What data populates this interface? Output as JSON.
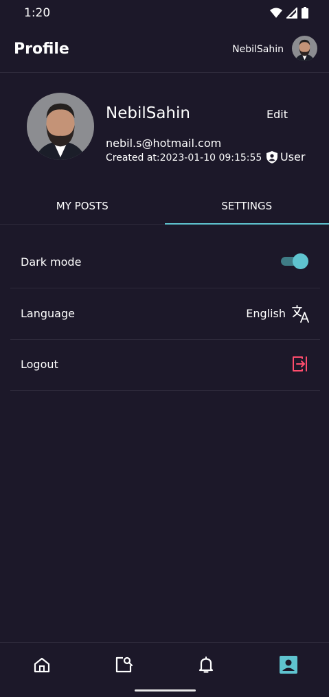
{
  "status": {
    "time": "1:20"
  },
  "app_bar": {
    "title": "Profile",
    "username": "NebilSahin"
  },
  "profile": {
    "name": "NebilSahin",
    "edit_label": "Edit",
    "email": "nebil.s@hotmail.com",
    "created": "Created at:2023-01-10 09:15:55",
    "role": "User"
  },
  "tabs": [
    {
      "label": "MY POSTS",
      "active": false
    },
    {
      "label": "SETTINGS",
      "active": true
    }
  ],
  "settings": {
    "dark_mode": {
      "label": "Dark mode",
      "enabled": true
    },
    "language": {
      "label": "Language",
      "value": "English",
      "icon": "translate-icon"
    },
    "logout": {
      "label": "Logout",
      "icon": "logout-icon"
    }
  },
  "bottom_nav": [
    {
      "icon": "home-icon",
      "active": false
    },
    {
      "icon": "search-post-icon",
      "active": false
    },
    {
      "icon": "bell-icon",
      "active": false
    },
    {
      "icon": "account-box-icon",
      "active": true
    }
  ],
  "colors": {
    "background": "#1c1829",
    "accent": "#5fc3cf",
    "danger": "#ff4d6d",
    "divider": "#2f2b3c"
  }
}
